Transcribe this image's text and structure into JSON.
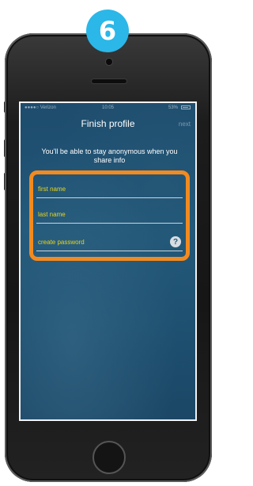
{
  "step_badge": "6",
  "status_bar": {
    "carrier": "●●●●○ Verizon",
    "time": "10:05",
    "battery": "53%"
  },
  "nav": {
    "title": "Finish profile",
    "next_label": "next"
  },
  "subtitle": "You'll be able to stay anonymous when you share info",
  "fields": {
    "first_name_placeholder": "first name",
    "last_name_placeholder": "last name",
    "password_placeholder": "create password",
    "help_glyph": "?"
  },
  "colors": {
    "badge": "#2bb7e8",
    "highlight": "#f38a1f",
    "placeholder": "#e8d51c",
    "screen_bg": "#1f5275"
  }
}
